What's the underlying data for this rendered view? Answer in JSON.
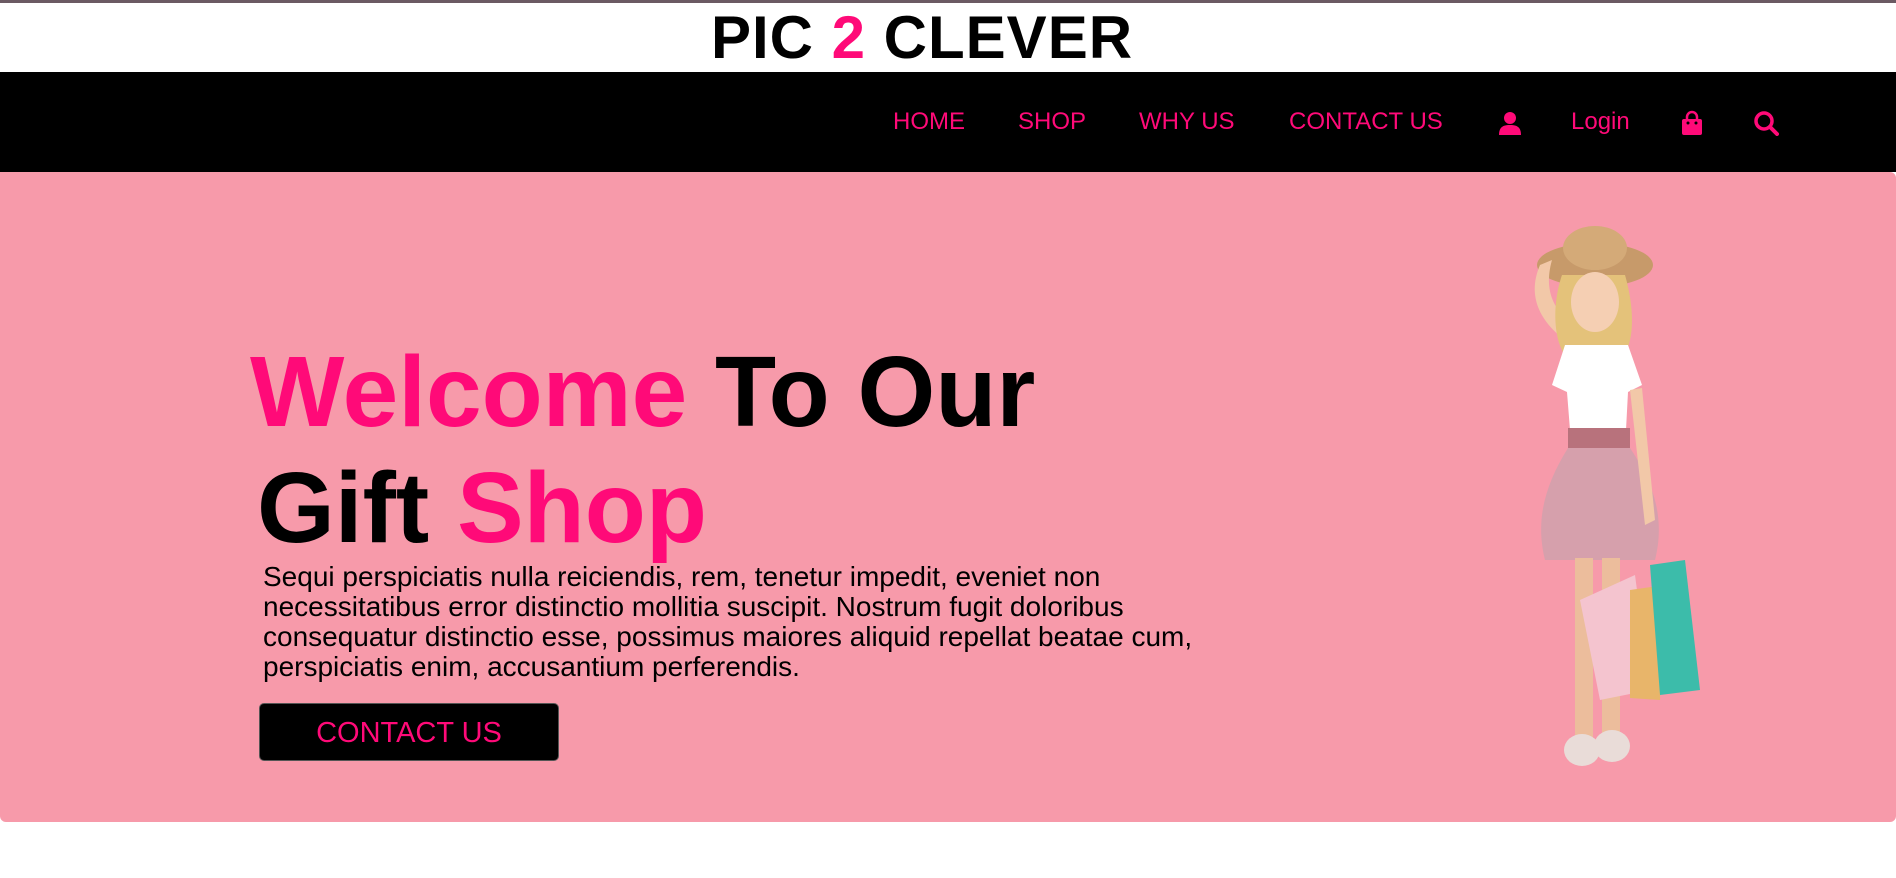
{
  "brand": {
    "part1": "PIC ",
    "part2": "2",
    "part3": " CLEVER"
  },
  "nav": {
    "home": "HOME",
    "shop": "SHOP",
    "why_us": "WHY US",
    "contact_us": "CONTACT US",
    "login": "Login",
    "icons": [
      "user-icon",
      "shopping-bag-icon",
      "search-icon"
    ]
  },
  "hero": {
    "headline_word1": "Welcome",
    "headline_word2": "To Our",
    "headline_word3": "Gift",
    "headline_word4": "Shop",
    "description": "Sequi perspiciatis nulla reiciendis, rem, tenetur impedit, eveniet non necessitatibus error distinctio mollitia suscipit. Nostrum fugit doloribus consequatur distinctio esse, possimus maiores aliquid repellat beatae cum, perspiciatis enim, accusantium perferendis.",
    "cta_label": "CONTACT US",
    "image": "girl-with-shopping-bags"
  },
  "colors": {
    "accent": "#ff0a78",
    "hero_bg": "#f79aaa",
    "nav_bg": "#000000"
  }
}
